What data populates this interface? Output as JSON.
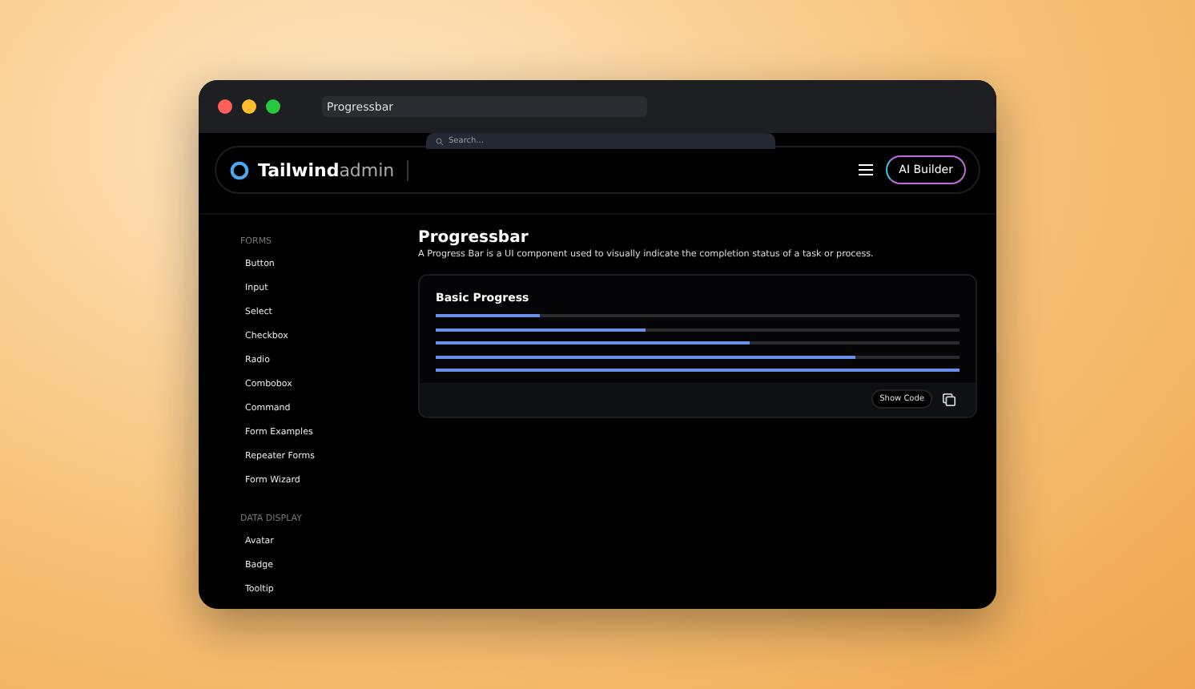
{
  "window": {
    "title": "Progressbar"
  },
  "search": {
    "placeholder": "Search..."
  },
  "header": {
    "logo_bold": "Tailwind",
    "logo_light": "admin",
    "button": "AI Builder"
  },
  "sidebar": {
    "sections": [
      {
        "heading": "FORMS",
        "items": [
          {
            "label": "Button"
          },
          {
            "label": "Input"
          },
          {
            "label": "Select"
          },
          {
            "label": "Checkbox"
          },
          {
            "label": "Radio"
          },
          {
            "label": "Combobox"
          },
          {
            "label": "Command"
          },
          {
            "label": "Form Examples"
          },
          {
            "label": "Repeater Forms"
          },
          {
            "label": "Form Wizard"
          }
        ]
      },
      {
        "heading": "DATA DISPLAY",
        "items": [
          {
            "label": "Avatar"
          },
          {
            "label": "Badge"
          },
          {
            "label": "Tooltip"
          }
        ]
      }
    ]
  },
  "page": {
    "title": "Progressbar",
    "description": "A Progress Bar is a UI component used to visually indicate the completion status of a task or process."
  },
  "card": {
    "title": "Basic Progress",
    "bars": [
      {
        "level": 0.2
      },
      {
        "level": 0.4
      },
      {
        "level": 0.6
      },
      {
        "level": 0.8
      },
      {
        "level": 1.0
      }
    ],
    "show_code": "Show Code"
  }
}
